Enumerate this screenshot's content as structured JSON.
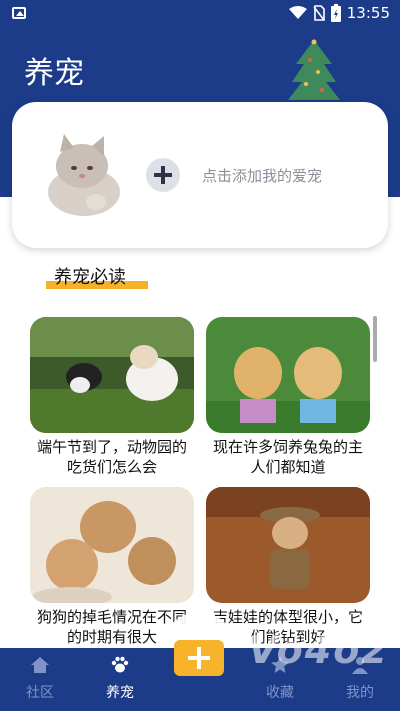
{
  "status_bar": {
    "time": "13:55"
  },
  "header": {
    "title": "养宠"
  },
  "add_pet": {
    "prompt": "点击添加我的爱宠"
  },
  "section": {
    "title": "养宠必读"
  },
  "articles": [
    {
      "title": "端午节到了，动物园的吃货们怎么会"
    },
    {
      "title": "现在许多饲养兔兔的主人们都知道"
    },
    {
      "title": "狗狗的掉毛情况在不同的时期有很大"
    },
    {
      "title": "吉娃娃的体型很小，它们能钻到好"
    }
  ],
  "tabs": [
    {
      "label": "社区",
      "icon": "home-icon"
    },
    {
      "label": "养宠",
      "icon": "paw-icon"
    },
    {
      "label": "收藏",
      "icon": "star-icon"
    },
    {
      "label": "我的",
      "icon": "user-icon"
    }
  ],
  "watermark": "Vo4o2",
  "colors": {
    "primary": "#1c3c8a",
    "accent": "#f5b229"
  }
}
